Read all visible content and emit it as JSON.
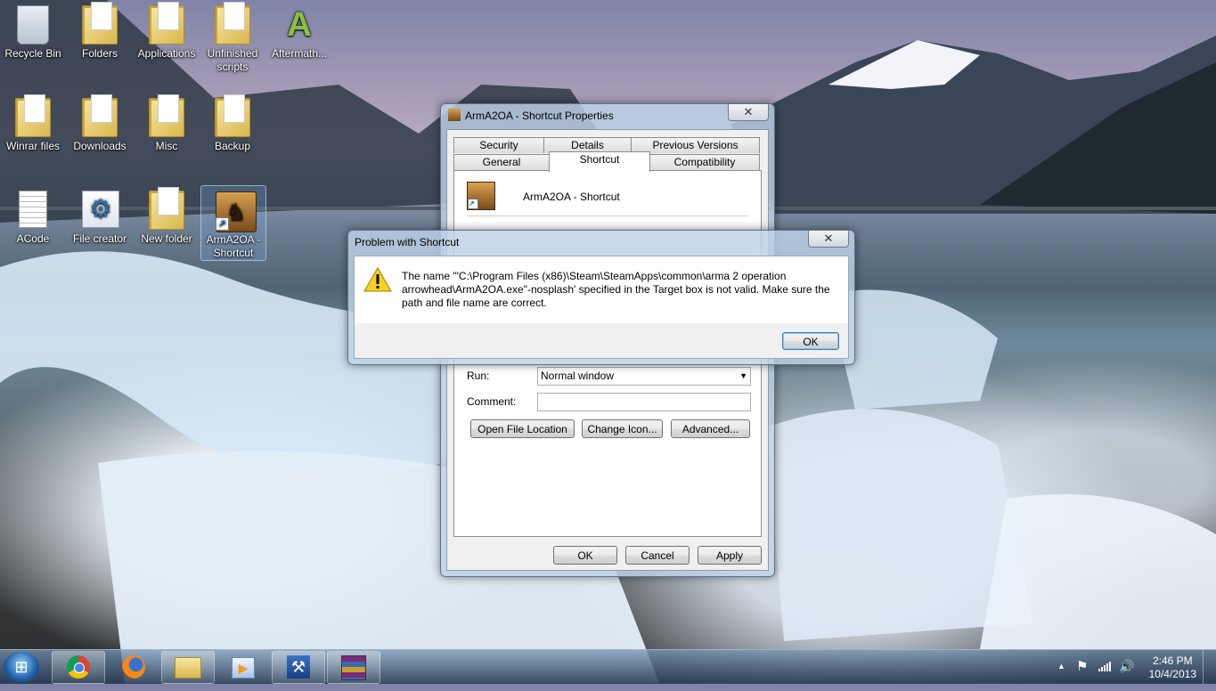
{
  "desktop": {
    "icons": [
      {
        "label": "Recycle Bin"
      },
      {
        "label": "Folders"
      },
      {
        "label": "Applications"
      },
      {
        "label": "Unfinished scripts"
      },
      {
        "label": "Aftermath..."
      },
      {
        "label": "Winrar files"
      },
      {
        "label": "Downloads"
      },
      {
        "label": "Misc"
      },
      {
        "label": "Backup"
      },
      {
        "label": "ACode"
      },
      {
        "label": "File creator"
      },
      {
        "label": "New folder"
      },
      {
        "label": "ArmA2OA - Shortcut"
      }
    ]
  },
  "properties": {
    "title": "ArmA2OA - Shortcut Properties",
    "close_glyph": "✕",
    "tabs_row1": [
      "Security",
      "Details",
      "Previous Versions"
    ],
    "tabs_row2": [
      "General",
      "Shortcut",
      "Compatibility"
    ],
    "shortcut_name": "ArmA2OA - Shortcut",
    "run_label": "Run:",
    "run_value": "Normal window",
    "comment_label": "Comment:",
    "comment_value": "",
    "btn_open_location": "Open File Location",
    "btn_change_icon": "Change Icon...",
    "btn_advanced": "Advanced...",
    "btn_ok": "OK",
    "btn_cancel": "Cancel",
    "btn_apply": "Apply"
  },
  "error_dialog": {
    "title": "Problem with Shortcut",
    "close_glyph": "✕",
    "message": "The name '\"C:\\Program Files (x86)\\Steam\\SteamApps\\common\\arma 2 operation arrowhead\\ArmA2OA.exe\"-nosplash' specified in the Target box is not valid. Make sure the path and file name are correct.",
    "ok_label": "OK"
  },
  "taskbar": {
    "time": "2:46 PM",
    "date": "10/4/2013",
    "tray_up_glyph": "▲",
    "flag_glyph": "⚑",
    "network_glyph": "▮",
    "volume_glyph": "🔊"
  },
  "icons": {
    "start": "start-orb-icon",
    "chrome": "chrome-icon",
    "firefox": "firefox-icon",
    "explorer": "explorer-icon",
    "media": "media-player-icon",
    "tool": "tool-icon",
    "winrar": "winrar-icon"
  },
  "colors": {
    "taskbar": "#2a3f5a",
    "window_frame": "#bed2e6",
    "default_button": "#3c7fb1"
  }
}
